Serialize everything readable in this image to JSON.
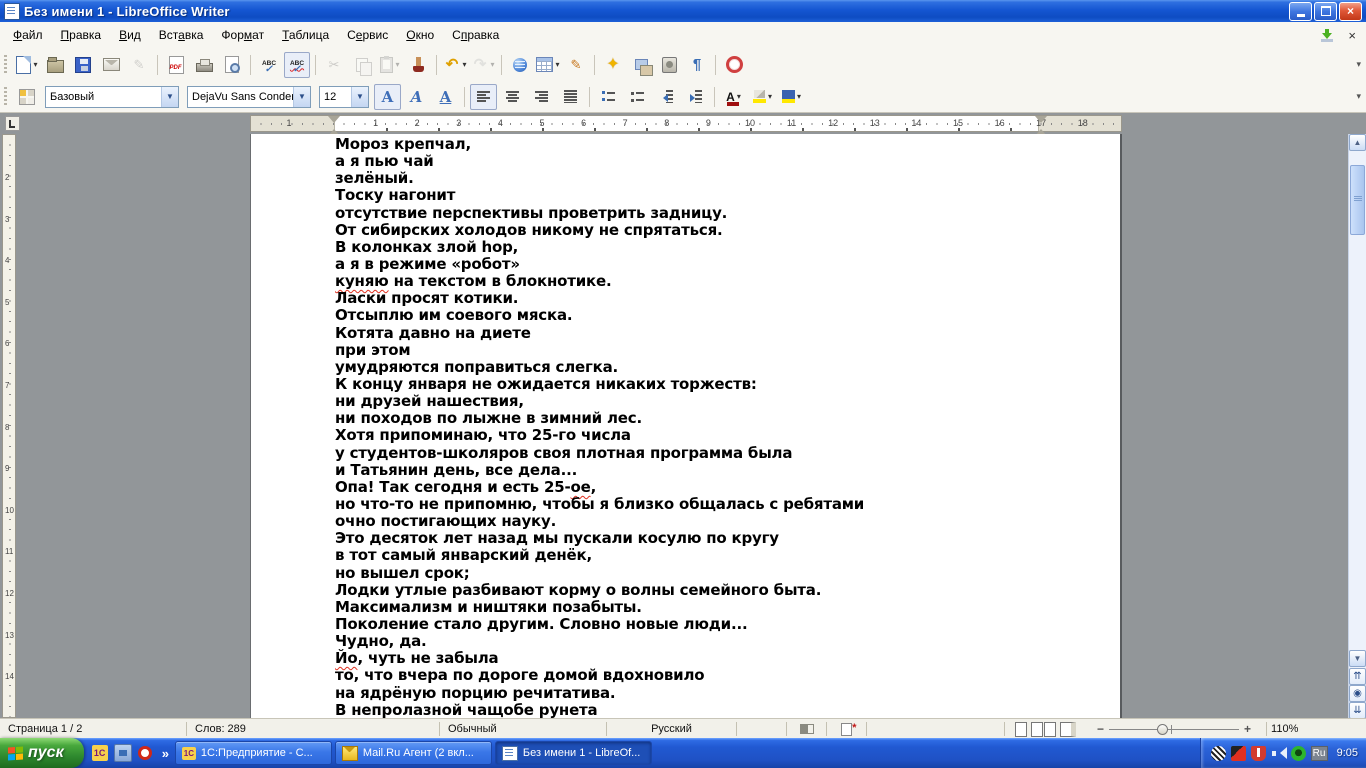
{
  "window": {
    "title": "Без имени 1 - LibreOffice Writer"
  },
  "menu": {
    "items": [
      {
        "id": "file",
        "pre": "",
        "u": "Ф",
        "post": "айл"
      },
      {
        "id": "edit",
        "pre": "",
        "u": "П",
        "post": "равка"
      },
      {
        "id": "view",
        "pre": "",
        "u": "В",
        "post": "ид"
      },
      {
        "id": "insert",
        "pre": "Вст",
        "u": "а",
        "post": "вка"
      },
      {
        "id": "format",
        "pre": "Фор",
        "u": "м",
        "post": "ат"
      },
      {
        "id": "table",
        "pre": "",
        "u": "Т",
        "post": "аблица"
      },
      {
        "id": "tools",
        "pre": "С",
        "u": "е",
        "post": "рвис"
      },
      {
        "id": "window",
        "pre": "",
        "u": "О",
        "post": "кно"
      },
      {
        "id": "help",
        "pre": "С",
        "u": "п",
        "post": "равка"
      }
    ],
    "update_icon": "update-available-icon",
    "close_doc_icon": "close-document-icon"
  },
  "standard_toolbar": [
    {
      "name": "new-document",
      "icon": "ic-new",
      "dd": true
    },
    {
      "name": "open",
      "icon": "ic-open"
    },
    {
      "name": "save",
      "icon": "ic-save"
    },
    {
      "name": "email-document",
      "icon": "ic-mail"
    },
    {
      "name": "edit-file",
      "icon": "ic-edit",
      "glyph": "✎",
      "disabled": true
    },
    {
      "sep": true
    },
    {
      "name": "export-pdf",
      "icon": "ic-pdf"
    },
    {
      "name": "print",
      "icon": "ic-print"
    },
    {
      "name": "page-preview",
      "icon": "ic-preview"
    },
    {
      "sep": true
    },
    {
      "name": "spelling",
      "icon": "ic-spell",
      "glyph": "ABC"
    },
    {
      "name": "auto-spellcheck",
      "icon": "ic-autospell",
      "glyph": "ABC",
      "pressed": true
    },
    {
      "sep": true
    },
    {
      "name": "cut",
      "icon": "ic-cut",
      "glyph": "✂",
      "disabled": true
    },
    {
      "name": "copy",
      "icon": "ic-copy",
      "disabled": true
    },
    {
      "name": "paste",
      "icon": "ic-paste",
      "disabled": true,
      "dd": true
    },
    {
      "name": "clone-formatting",
      "icon": "ic-brush"
    },
    {
      "sep": true
    },
    {
      "name": "undo",
      "icon": "ic-undo",
      "glyph": "↶",
      "dd": true
    },
    {
      "name": "redo",
      "icon": "ic-redo",
      "glyph": "↷",
      "disabled": true,
      "dd": true
    },
    {
      "sep": true
    },
    {
      "name": "hyperlink",
      "icon": "ic-link"
    },
    {
      "name": "insert-table",
      "icon": "ic-table",
      "dd": true
    },
    {
      "name": "draw-functions",
      "icon": "ic-draw",
      "glyph": "✎"
    },
    {
      "sep": true
    },
    {
      "name": "navigator",
      "icon": "ic-navigator",
      "glyph": "✦"
    },
    {
      "name": "gallery",
      "icon": "ic-gallery"
    },
    {
      "name": "data-sources",
      "icon": "ic-datasrc"
    },
    {
      "name": "formatting-marks",
      "icon": "ic-para",
      "glyph": "¶"
    },
    {
      "sep": true
    },
    {
      "name": "help",
      "icon": "ic-help"
    }
  ],
  "formatting_toolbar": {
    "style_value": "Базовый",
    "font_value": "DejaVu Sans Conder",
    "size_value": "12",
    "buttons": [
      {
        "name": "bold",
        "cls": "bo",
        "letter": "A",
        "pressed": true
      },
      {
        "name": "italic",
        "cls": "it",
        "letter": "A"
      },
      {
        "name": "underline",
        "cls": "un",
        "letter": "A"
      },
      {
        "sep": true
      },
      {
        "name": "align-left",
        "cls": "b-al",
        "pressed": true
      },
      {
        "name": "align-center",
        "cls": "b-ac"
      },
      {
        "name": "align-right",
        "cls": "b-ar"
      },
      {
        "name": "align-justified",
        "cls": "b-aj"
      },
      {
        "sep": true
      },
      {
        "name": "numbered-list",
        "cls": "b-nl"
      },
      {
        "name": "bullet-list",
        "cls": "b-bl"
      },
      {
        "name": "decrease-indent",
        "cls": "b-out"
      },
      {
        "name": "increase-indent",
        "cls": "b-in"
      },
      {
        "sep": true
      },
      {
        "name": "font-color",
        "cls": "b-fc",
        "letter": "A",
        "dd": true
      },
      {
        "name": "highlighting",
        "cls": "b-hl",
        "dd": true
      },
      {
        "name": "background-color",
        "cls": "b-bg",
        "dd": true
      }
    ]
  },
  "ruler": {
    "margin_number": "1",
    "h_numbers": [
      1,
      2,
      3,
      4,
      5,
      6,
      7,
      8,
      9,
      10,
      11,
      12,
      13,
      14,
      15,
      16,
      17,
      18
    ],
    "v_numbers": [
      2,
      3,
      4,
      5,
      6,
      7,
      8,
      9,
      10,
      11,
      12,
      13,
      14
    ]
  },
  "document": {
    "lines": [
      [
        {
          "t": "Мороз крепчал,"
        }
      ],
      [
        {
          "t": "а я пью чай"
        }
      ],
      [
        {
          "t": "зелёный."
        }
      ],
      [
        {
          "t": "Тоску нагонит"
        }
      ],
      [
        {
          "t": "отсутствие перспективы проветрить задницу."
        }
      ],
      [
        {
          "t": "От сибирских холодов никому не спрятаться."
        }
      ],
      [
        {
          "t": "В колонках злой hop,"
        }
      ],
      [
        {
          "t": "а я в режиме «робот»"
        }
      ],
      [
        {
          "t": "куняю",
          "bad": true
        },
        {
          "t": " на текстом в блокнотике."
        }
      ],
      [
        {
          "t": "Ласки просят котики."
        }
      ],
      [
        {
          "t": "Отсыплю им соевого мяска."
        }
      ],
      [
        {
          "t": "Котята давно на диете"
        }
      ],
      [
        {
          "t": "при этом"
        }
      ],
      [
        {
          "t": "умудряются поправиться слегка."
        }
      ],
      [
        {
          "t": "К концу января не ожидается никаких торжеств:"
        }
      ],
      [
        {
          "t": "ни друзей нашествия,"
        }
      ],
      [
        {
          "t": "ни походов по лыжне в зимний лес."
        }
      ],
      [
        {
          "t": "Хотя припоминаю, что 25-го числа"
        }
      ],
      [
        {
          "t": "у студентов-школяров своя плотная программа была"
        }
      ],
      [
        {
          "t": "и Татьянин день, все дела..."
        }
      ],
      [
        {
          "t": "Опа! Так сегодня и есть 25-"
        },
        {
          "t": "ое",
          "bad": true
        },
        {
          "t": ","
        }
      ],
      [
        {
          "t": "но что-то не припомню, чтобы я близко общалась с ребятами"
        }
      ],
      [
        {
          "t": "очно постигающих науку."
        }
      ],
      [
        {
          "t": "Это десяток лет назад мы пускали косулю по кругу"
        }
      ],
      [
        {
          "t": "в тот самый январский денёк,"
        }
      ],
      [
        {
          "t": "но вышел срок;"
        }
      ],
      [
        {
          "t": "Лодки утлые разбивают корму о волны семейного быта."
        }
      ],
      [
        {
          "t": "Максимализм и ништяки позабыты."
        }
      ],
      [
        {
          "t": "Поколение стало другим. Словно новые люди..."
        }
      ],
      [
        {
          "t": "Чудно, да."
        }
      ],
      [
        {
          "t": "Йо",
          "bad": true
        },
        {
          "t": ", чуть не забыла"
        }
      ],
      [
        {
          "t": "то, что вчера по дороге домой вдохновило"
        }
      ],
      [
        {
          "t": "на ядрёную порцию речитатива."
        }
      ],
      [
        {
          "t": "В непролазной чащобе рунета"
        }
      ]
    ]
  },
  "statusbar": {
    "page": "Страница 1 / 2",
    "words": "Слов: 289",
    "para_style": "Обычный",
    "language": "Русский",
    "zoom_percent": "110%"
  },
  "taskbar": {
    "start_label": "пуск",
    "quick_launch": [
      {
        "name": "quick-launch-1c-icon",
        "cls": "q1c",
        "text": "1С"
      },
      {
        "name": "quick-launch-show-desktop-icon",
        "cls": "qdesk",
        "text": ""
      },
      {
        "name": "quick-launch-opera-icon",
        "cls": "qopera",
        "text": ""
      }
    ],
    "chevron": "»",
    "tasks": [
      {
        "label": "1С:Предприятие - С...",
        "icon": "t1c",
        "icon_name": "1c-task-icon",
        "icon_text": "1С",
        "active": false
      },
      {
        "label": "Mail.Ru Агент (2 вкл...",
        "icon": "tmail",
        "icon_name": "mail-envelope-icon",
        "icon_text": "",
        "active": false
      },
      {
        "label": "Без имени 1 - LibreOf...",
        "icon": "twriter",
        "icon_name": "writer-doc-icon",
        "icon_text": "",
        "active": true
      }
    ],
    "tray": {
      "icons": [
        {
          "name": "punto-switcher-tray-icon",
          "cls": "ti-punto"
        },
        {
          "name": "antivirus-tray-icon",
          "cls": "ti-kasp"
        },
        {
          "name": "shield-tray-icon",
          "cls": "ti-shield"
        },
        {
          "name": "volume-tray-icon",
          "cls": "ti-vol"
        },
        {
          "name": "mail-agent-tray-icon",
          "cls": "ti-icq"
        }
      ],
      "language": "Ru",
      "clock": "9:05"
    }
  }
}
